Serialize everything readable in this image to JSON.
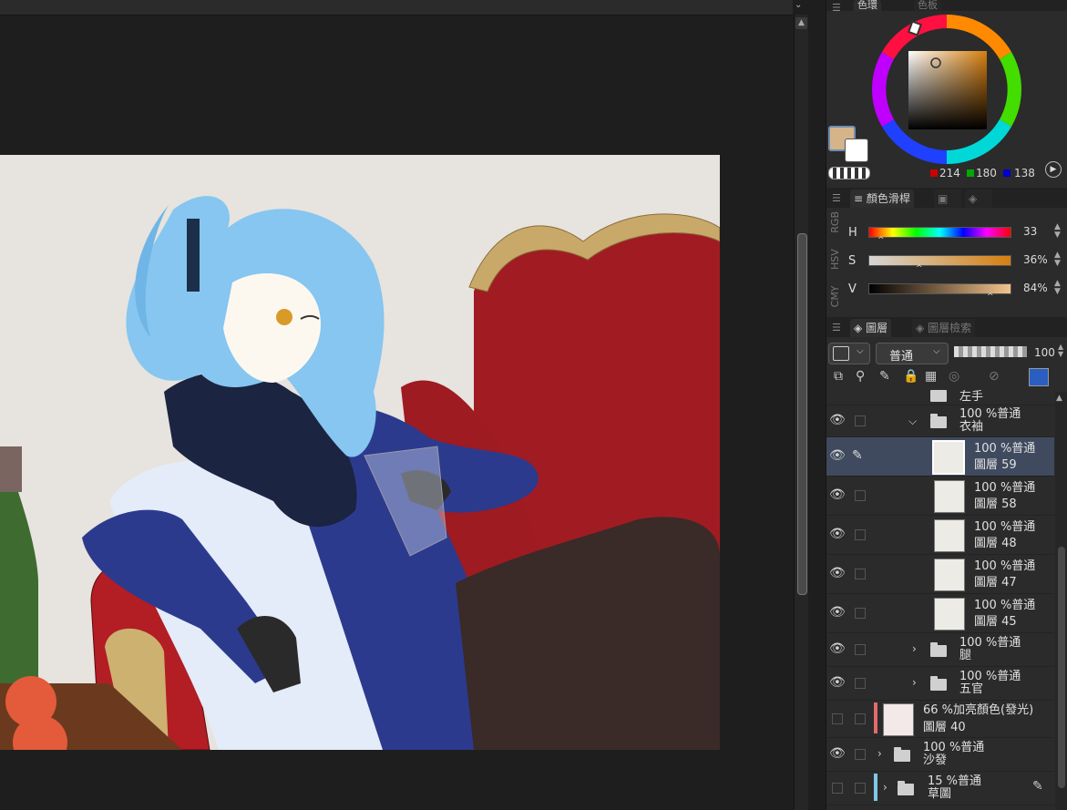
{
  "color_panel": {
    "tabs": [
      "色環",
      "色板"
    ],
    "rgb": {
      "r": "214",
      "g": "180",
      "b": "138"
    },
    "main_color": "#d6b48a",
    "sub_color": "#ffffff"
  },
  "slider_panel": {
    "tab_label": "顏色滑桿",
    "vertical_tabs": [
      "RGB",
      "HSV",
      "CMY"
    ],
    "sliders": [
      {
        "label": "H",
        "value": "33"
      },
      {
        "label": "S",
        "value": "36%"
      },
      {
        "label": "V",
        "value": "84%"
      }
    ]
  },
  "layer_panel": {
    "tabs": [
      "圖層",
      "圖層檢索"
    ],
    "blend_mode": "普通",
    "opacity": "100",
    "layers": [
      {
        "line1": "左手",
        "line2": "",
        "type": "folder-partial"
      },
      {
        "line1": "100 %普通",
        "line2": "衣袖",
        "type": "folder-open"
      },
      {
        "line1": "100 %普通",
        "line2": "圖層 59",
        "type": "layer",
        "selected": true
      },
      {
        "line1": "100 %普通",
        "line2": "圖層 58",
        "type": "layer"
      },
      {
        "line1": "100 %普通",
        "line2": "圖層 48",
        "type": "layer"
      },
      {
        "line1": "100 %普通",
        "line2": "圖層 47",
        "type": "layer"
      },
      {
        "line1": "100 %普通",
        "line2": "圖層 45",
        "type": "layer"
      },
      {
        "line1": "100 %普通",
        "line2": "腿",
        "type": "folder"
      },
      {
        "line1": "100 %普通",
        "line2": "五官",
        "type": "folder"
      },
      {
        "line1": "66 %加亮顏色(發光)",
        "line2": "圖層 40",
        "type": "layer"
      },
      {
        "line1": "100 %普通",
        "line2": "沙發",
        "type": "folder"
      },
      {
        "line1": "15 %普通",
        "line2": "草圖",
        "type": "folder"
      }
    ]
  }
}
